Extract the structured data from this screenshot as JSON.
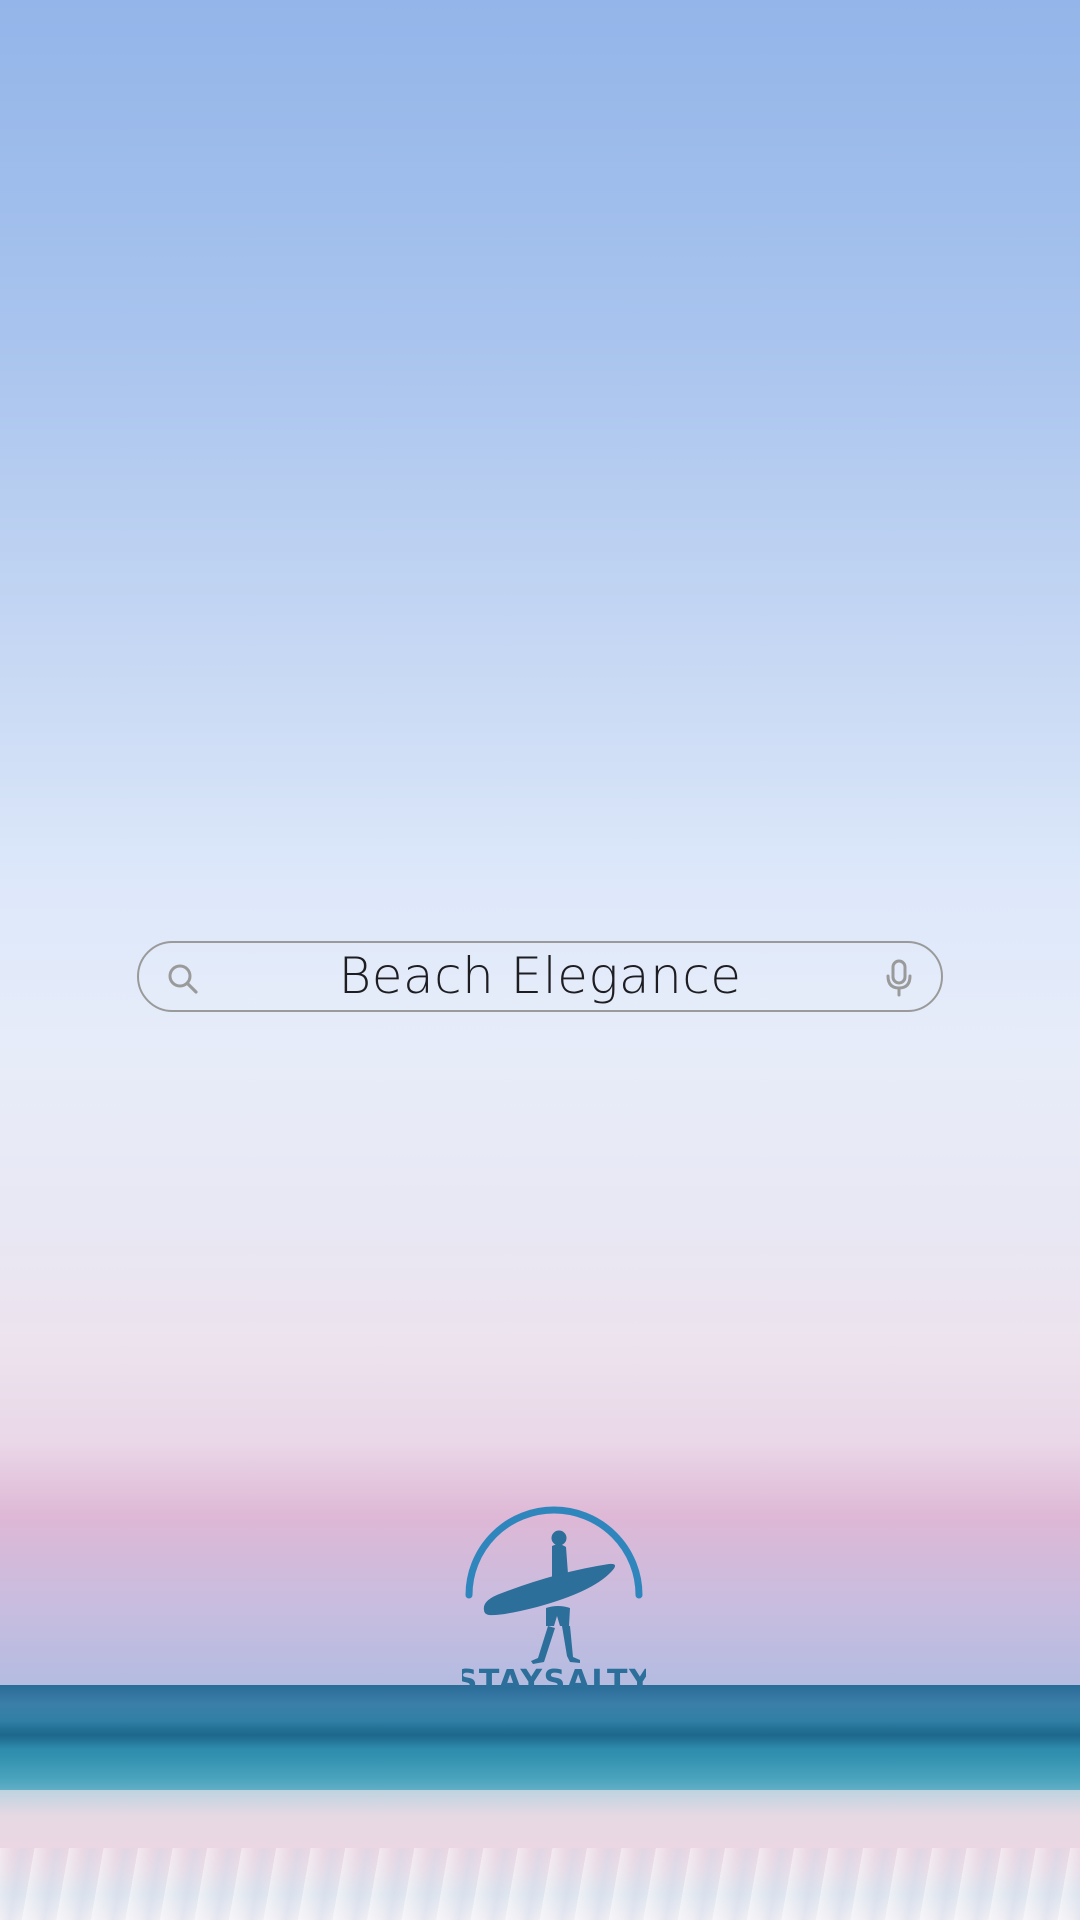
{
  "wallpaper": {
    "sky_top_color": "#93b5e9",
    "sky_mid_color": "#e7ecf9",
    "horizon_pink_color": "#deb8d6",
    "ocean_color": "#2d7fa3"
  },
  "search": {
    "value": "Beach Elegance",
    "search_icon": "search-icon",
    "voice_icon": "microphone-icon"
  },
  "logo": {
    "icon": "surfer-silhouette",
    "text": "STAYSALTY",
    "color": "#2b6f9a",
    "arch_color": "#2f86bd"
  }
}
